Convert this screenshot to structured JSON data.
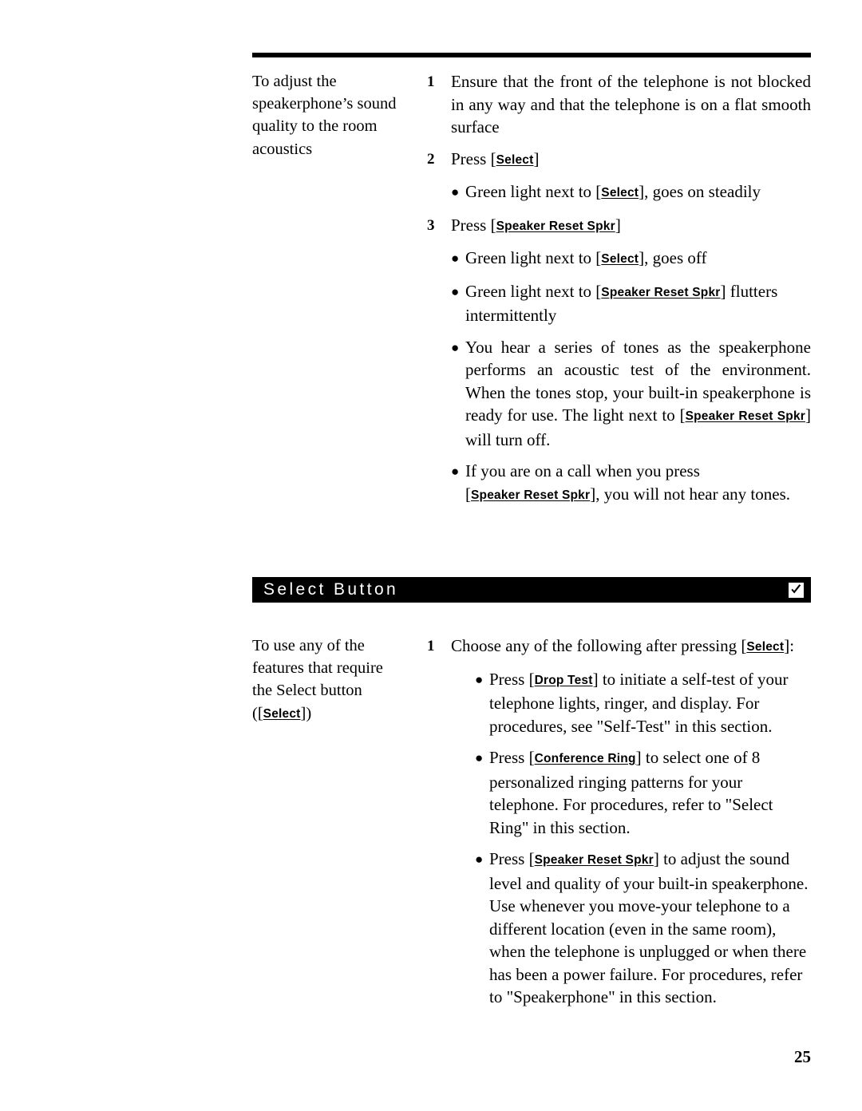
{
  "page": {
    "number": "25",
    "keys": {
      "select": "Select",
      "speaker_reset_spkr": "Speaker Reset Spkr",
      "drop_test": "Drop Test",
      "conference_ring": "Conference Ring"
    },
    "brackets": {
      "open": "[",
      "close": "]"
    }
  },
  "speakerphone_section": {
    "sidebar": {
      "line1": "To adjust the",
      "line2": "speakerphone’s sound",
      "line3": "quality to the room",
      "line4": "acoustics"
    },
    "steps": [
      {
        "num": "1",
        "text": "Ensure that the front of the telephone is not blocked in any way and that the telephone is on a flat smooth surface"
      },
      {
        "num": "2",
        "prefix": "Press",
        "key": "Select"
      },
      {
        "num": "3",
        "prefix": "Press",
        "key": "Speaker Reset Spkr"
      }
    ],
    "bullet_after_step2": {
      "prefix": "Green light next to",
      "key": "Select",
      "suffix": ",  goes on steadily"
    },
    "bullets_after_step3": [
      {
        "prefix": "Green light next to",
        "key": "Select",
        "suffix": ", goes off"
      },
      {
        "prefix": "Green light next to",
        "key": "Speaker Reset Spkr",
        "suffix": " flutters intermittently"
      },
      {
        "prefix": "You hear a series of tones as the speakerphone performs an acoustic test of the environment. When the tones stop, your built-in speakerphone is ready for use. The light next to",
        "key": "Speaker Reset Spkr",
        "suffix": " will turn off."
      },
      {
        "prefix": "If you are on a call when you press",
        "key": "Speaker Reset Spkr",
        "suffix": ", you will not hear any tones."
      }
    ]
  },
  "select_button_section": {
    "header": {
      "title": "Select Button",
      "icon": "checkbox-checked-icon"
    },
    "sidebar": {
      "line1": "To use any of the",
      "line2": "features that require",
      "line3": "the Select button",
      "paren_open": "([",
      "key": "Select",
      "paren_close": "])"
    },
    "step": {
      "num": "1",
      "prefix": "Choose any of the following after pressing",
      "key": "Select",
      "suffix": ":"
    },
    "bullets": [
      {
        "prefix": "Press",
        "key": "Drop Test",
        "suffix": " to initiate a self-test of your telephone lights, ringer, and display. For procedures, see \"Self-Test\" in this section."
      },
      {
        "prefix": "Press",
        "key": "Conference Ring",
        "suffix": " to select one of 8 personalized ringing patterns for your telephone. For procedures, refer to \"Select Ring\" in this section."
      },
      {
        "prefix": "Press",
        "key": "Speaker Reset Spkr",
        "suffix": " to adjust the sound level and quality of your built-in speakerphone. Use whenever you move-your telephone to a different location (even in the same room), when the telephone is unplugged or when there has been a power failure. For procedures, refer to \"Speakerphone\" in this section."
      }
    ]
  }
}
